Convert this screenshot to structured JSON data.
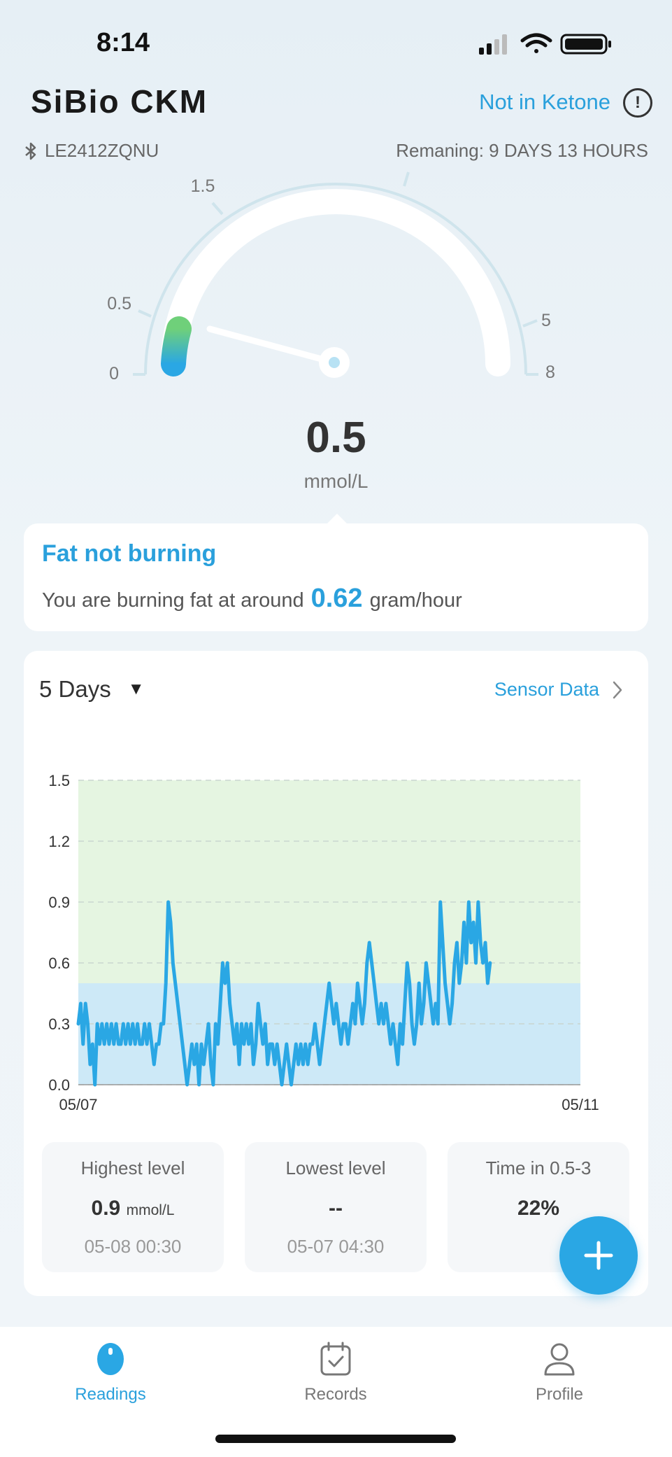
{
  "status_bar": {
    "time": "8:14"
  },
  "header": {
    "title": "SiBio CKM",
    "ketone_status": "Not in Ketone",
    "device_id": "LE2412ZQNU",
    "remaining": "Remaning:  9 DAYS 13 HOURS"
  },
  "gauge": {
    "value": "0.5",
    "unit": "mmol/L",
    "tick_labels": [
      "0",
      "0.5",
      "1.5",
      "5",
      "8"
    ]
  },
  "fat_card": {
    "title": "Fat not burning",
    "desc_prefix": "You are burning fat at around",
    "rate": "0.62",
    "rate_unit": "gram/hour"
  },
  "chart_section": {
    "range": "5 Days",
    "sensor_link": "Sensor Data"
  },
  "chart_data": {
    "type": "line",
    "ylim": [
      0,
      1.5
    ],
    "y_ticks": [
      "0.0",
      "0.3",
      "0.6",
      "0.9",
      "1.2",
      "1.5"
    ],
    "x_tick_labels": [
      "05/07",
      "05/11"
    ],
    "bands": [
      {
        "from": 0,
        "to": 0.5,
        "color": "#cde9f7"
      },
      {
        "from": 0.5,
        "to": 1.5,
        "color": "#e5f5e1"
      }
    ],
    "series": [
      {
        "color": "#2aa7e4",
        "values": [
          0.3,
          0.4,
          0.2,
          0.4,
          0.3,
          0.1,
          0.2,
          0.0,
          0.3,
          0.2,
          0.3,
          0.2,
          0.3,
          0.2,
          0.3,
          0.2,
          0.3,
          0.2,
          0.2,
          0.3,
          0.2,
          0.3,
          0.2,
          0.3,
          0.2,
          0.3,
          0.2,
          0.2,
          0.3,
          0.2,
          0.3,
          0.2,
          0.1,
          0.2,
          0.2,
          0.3,
          0.3,
          0.5,
          0.9,
          0.8,
          0.6,
          0.5,
          0.4,
          0.3,
          0.2,
          0.1,
          0.0,
          0.1,
          0.2,
          0.1,
          0.2,
          0.0,
          0.2,
          0.1,
          0.2,
          0.3,
          0.1,
          0.0,
          0.3,
          0.2,
          0.4,
          0.6,
          0.5,
          0.6,
          0.4,
          0.3,
          0.2,
          0.3,
          0.1,
          0.3,
          0.2,
          0.3,
          0.2,
          0.3,
          0.1,
          0.2,
          0.4,
          0.3,
          0.2,
          0.3,
          0.1,
          0.2,
          0.2,
          0.1,
          0.2,
          0.1,
          0.0,
          0.1,
          0.2,
          0.1,
          0.0,
          0.1,
          0.2,
          0.1,
          0.2,
          0.1,
          0.2,
          0.1,
          0.2,
          0.2,
          0.3,
          0.2,
          0.1,
          0.2,
          0.3,
          0.4,
          0.5,
          0.4,
          0.3,
          0.4,
          0.3,
          0.2,
          0.3,
          0.3,
          0.2,
          0.3,
          0.4,
          0.3,
          0.5,
          0.4,
          0.3,
          0.4,
          0.6,
          0.7,
          0.6,
          0.5,
          0.4,
          0.3,
          0.4,
          0.3,
          0.4,
          0.3,
          0.2,
          0.3,
          0.2,
          0.1,
          0.3,
          0.2,
          0.4,
          0.6,
          0.5,
          0.3,
          0.2,
          0.3,
          0.5,
          0.3,
          0.4,
          0.6,
          0.5,
          0.4,
          0.3,
          0.4,
          0.3,
          0.9,
          0.7,
          0.5,
          0.4,
          0.3,
          0.4,
          0.6,
          0.7,
          0.5,
          0.6,
          0.8,
          0.6,
          0.9,
          0.7,
          0.8,
          0.6,
          0.9,
          0.7,
          0.6,
          0.7,
          0.5,
          0.6
        ]
      }
    ]
  },
  "stats": [
    {
      "label": "Highest level",
      "value": "0.9",
      "unit": "mmol/L",
      "time": "05-08 00:30"
    },
    {
      "label": "Lowest level",
      "value": "--",
      "unit": "",
      "time": "05-07 04:30"
    },
    {
      "label": "Time in 0.5-3",
      "value": "22%",
      "unit": "",
      "time": ""
    }
  ],
  "nav": {
    "readings": "Readings",
    "records": "Records",
    "profile": "Profile"
  },
  "colors": {
    "accent": "#2aa0dc",
    "fab": "#2aa7e4"
  }
}
